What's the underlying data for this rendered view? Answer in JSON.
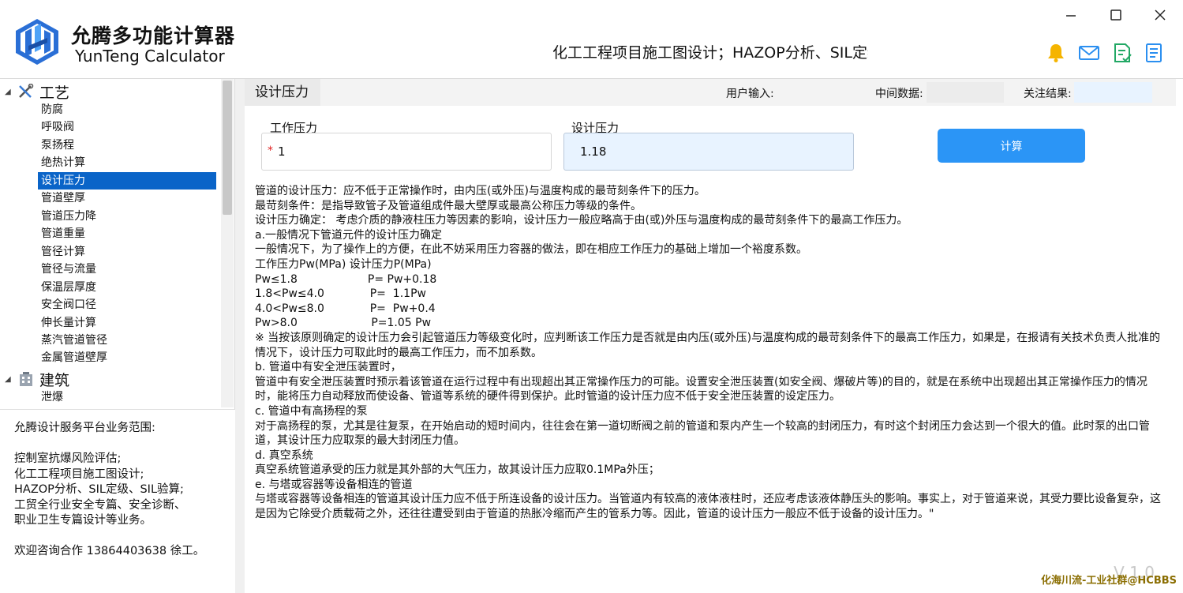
{
  "app": {
    "title": "允腾多功能计算器",
    "subtitle": "YunTeng Calculator",
    "marquee": "化工工程项目施工图设计；HAZOP分析、SIL定级、SIL验算",
    "brand_color": "#2a6fd6"
  },
  "window_controls": {
    "minimize_icon": "minimize-icon",
    "maximize_icon": "maximize-icon",
    "close_icon": "close-icon"
  },
  "header_icons": [
    "bell-icon",
    "mail-icon",
    "document-check-icon",
    "notes-icon"
  ],
  "sidebar": {
    "groups": [
      {
        "label": "工艺",
        "icon": "tools-icon",
        "expanded": true,
        "items": [
          "防腐",
          "呼吸阀",
          "泵扬程",
          "绝热计算",
          "设计压力",
          "管道壁厚",
          "管道压力降",
          "管道重量",
          "管径计算",
          "管径与流量",
          "保温层厚度",
          "安全阀口径",
          "伸长量计算",
          "蒸汽管道管径",
          "金属管道壁厚"
        ]
      },
      {
        "label": "建筑",
        "icon": "building-icon",
        "expanded": true,
        "items": [
          "泄爆"
        ]
      }
    ],
    "selected_item": "设计压力",
    "info": [
      "允腾设计服务平台业务范围:",
      "",
      "控制室抗爆风险评估;",
      "化工工程项目施工图设计;",
      "HAZOP分析、SIL定级、SIL验算;",
      "工贸全行业安全专篇、安全诊断、",
      "职业卫生专篇设计等业务。",
      "",
      "欢迎咨询合作 13864403638 徐工。"
    ]
  },
  "main": {
    "tab_title": "设计压力",
    "legend": {
      "user_input": "用户输入:",
      "intermediate": "中间数据:",
      "result": "关注结果:",
      "intermediate_color": "#f2f2f2",
      "result_color": "#e8f3ff"
    },
    "working_pressure": {
      "label": "工作压力",
      "value": "1",
      "required_mark": "*"
    },
    "design_pressure": {
      "label": "设计压力",
      "value": "1.18"
    },
    "calc_button": "计算",
    "description": [
      "管道的设计压力：应不低于正常操作时，由内压(或外压)与温度构成的最苛刻条件下的压力。",
      "最苛刻条件：是指导致管子及管道组成件最大壁厚或最高公称压力等级的条件。",
      "设计压力确定： 考虑介质的静液柱压力等因素的影响，设计压力一般应略高于由(或)外压与温度构成的最苛刻条件下的最高工作压力。",
      "a.一般情况下管道元件的设计压力确定",
      "一般情况下，为了操作上的方便，在此不妨采用压力容器的做法，即在相应工作压力的基础上增加一个裕度系数。",
      "工作压力Pw(MPa) 设计压力P(MPa)",
      "Pw≤1.8                    P= Pw+0.18",
      "1.8<Pw≤4.0             P=  1.1Pw",
      "4.0<Pw≤8.0             P=  Pw+0.4",
      "Pw>8.0                     P=1.05 Pw",
      "※ 当按该原则确定的设计压力会引起管道压力等级变化时，应判断该工作压力是否就是由内压(或外压)与温度构成的最苛刻条件下的最高工作压力，如果是，在报请有关技术负责人批准的情况下，设计压力可取此时的最高工作压力，而不加系数。",
      "b. 管道中有安全泄压装置时，",
      "管道中有安全泄压装置时预示着该管道在运行过程中有出现超出其正常操作压力的可能。设置安全泄压装置(如安全阀、爆破片等)的目的，就是在系统中出现超出其正常操作压力的情况时，能将压力自动释放而使设备、管道等系统的硬件得到保护。此时管道的设计压力应不低于安全泄压装置的设定压力。",
      "c. 管道中有高扬程的泵",
      "对于高扬程的泵，尤其是往复泵，在开始启动的短时间内，往往会在第一道切断阀之前的管道和泵内产生一个较高的封闭压力，有时这个封闭压力会达到一个很大的值。此时泵的出口管道，其设计压力应取泵的最大封闭压力值。",
      "d. 真空系统",
      "真空系统管道承受的压力就是其外部的大气压力，故其设计压力应取0.1MPa外压；",
      "e. 与塔或容器等设备相连的管道",
      "与塔或容器等设备相连的管道其设计压力应不低于所连设备的设计压力。当管道内有较高的液体液柱时，还应考虑该液体静压头的影响。事实上，对于管道来说，其受力要比设备复杂，这是因为它除受介质载荷之外，还往往遭受到由于管道的热胀冷缩而产生的管系力等。因此，管道的设计压力一般应不低于设备的设计压力。\""
    ],
    "version": "V 1.0",
    "watermark": "化海川流-工业社群@HCBBS"
  }
}
